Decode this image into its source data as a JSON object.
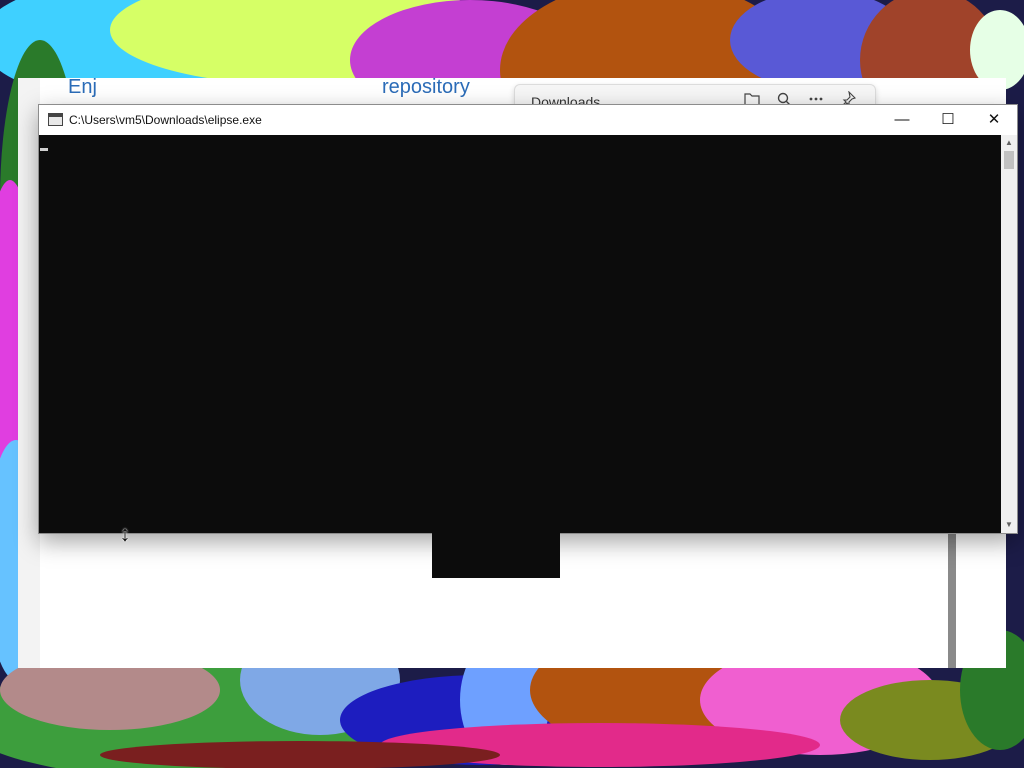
{
  "console": {
    "title": "C:\\Users\\vm5\\Downloads\\elipse.exe",
    "buttons": {
      "minimize": "—",
      "maximize": "☐",
      "close": "✕"
    },
    "scroll_arrows": {
      "up": "▲",
      "down": "▼"
    }
  },
  "background_browser": {
    "partial_title_left": "Enj",
    "partial_title_center": "repository"
  },
  "downloads": {
    "title": "Downloads",
    "tool_icons": [
      "folder-icon",
      "search-icon",
      "more-icon",
      "pin-icon"
    ]
  },
  "cursor": {
    "glyph": "↕"
  },
  "colors": {
    "console_background": "#0c0c0c",
    "title_bar": "#ffffff",
    "link_blue": "#2b6cb8"
  }
}
